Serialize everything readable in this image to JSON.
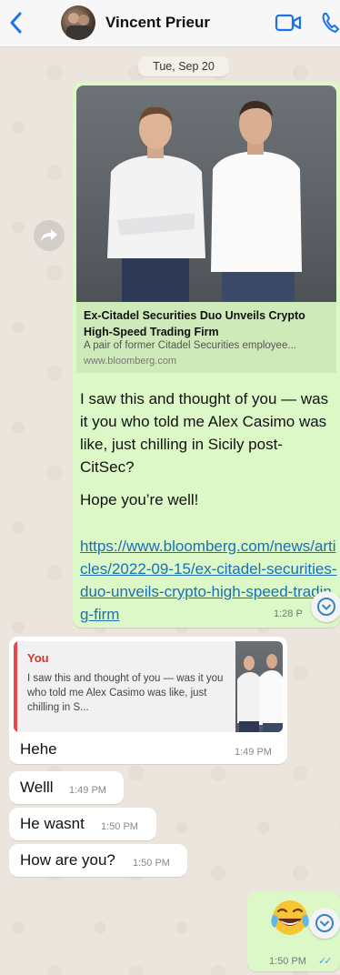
{
  "header": {
    "contact_name": "Vincent Prieur",
    "back_icon": "chevron-left-icon",
    "video_icon": "video-call-icon",
    "phone_icon": "phone-icon",
    "accent": "#1a73e8"
  },
  "date_separator": "Tue, Sep 20",
  "messages": {
    "link_message": {
      "preview_title": "Ex-Citadel Securities Duo Unveils Crypto High-Speed Trading Firm",
      "preview_description": "A pair of former Citadel Securities employee...",
      "preview_domain": "www.bloomberg.com",
      "text": "I saw this and thought of you — was it you who told me Alex Casimo was like, just chilling in Sicily post- CitSec?",
      "text2": "Hope you’re well!",
      "url": "https://www.bloomberg.com/news/articles/2022-09-15/ex-citadel-securities-duo-unveils-crypto-high-speed-trading-firm",
      "time": "1:28 P"
    },
    "reply_message": {
      "quoted_author": "You",
      "quoted_text": "I saw this and thought of you — was it you who told me Alex Casimo was like, just chilling in S...",
      "text": "Hehe",
      "time": "1:49 PM"
    },
    "incoming": [
      {
        "text": "Welll",
        "time": "1:49 PM"
      },
      {
        "text": "He wasnt",
        "time": "1:50 PM"
      },
      {
        "text": "How are you?",
        "time": "1:50 PM"
      }
    ],
    "emoji_message": {
      "emoji": "face-with-tears-of-joy",
      "time": "1:50 PM",
      "status": "read"
    }
  },
  "colors": {
    "outgoing_bubble": "#dcf8c6",
    "incoming_bubble": "#ffffff",
    "link": "#1a6fb5",
    "quote_accent": "#e5494d"
  }
}
